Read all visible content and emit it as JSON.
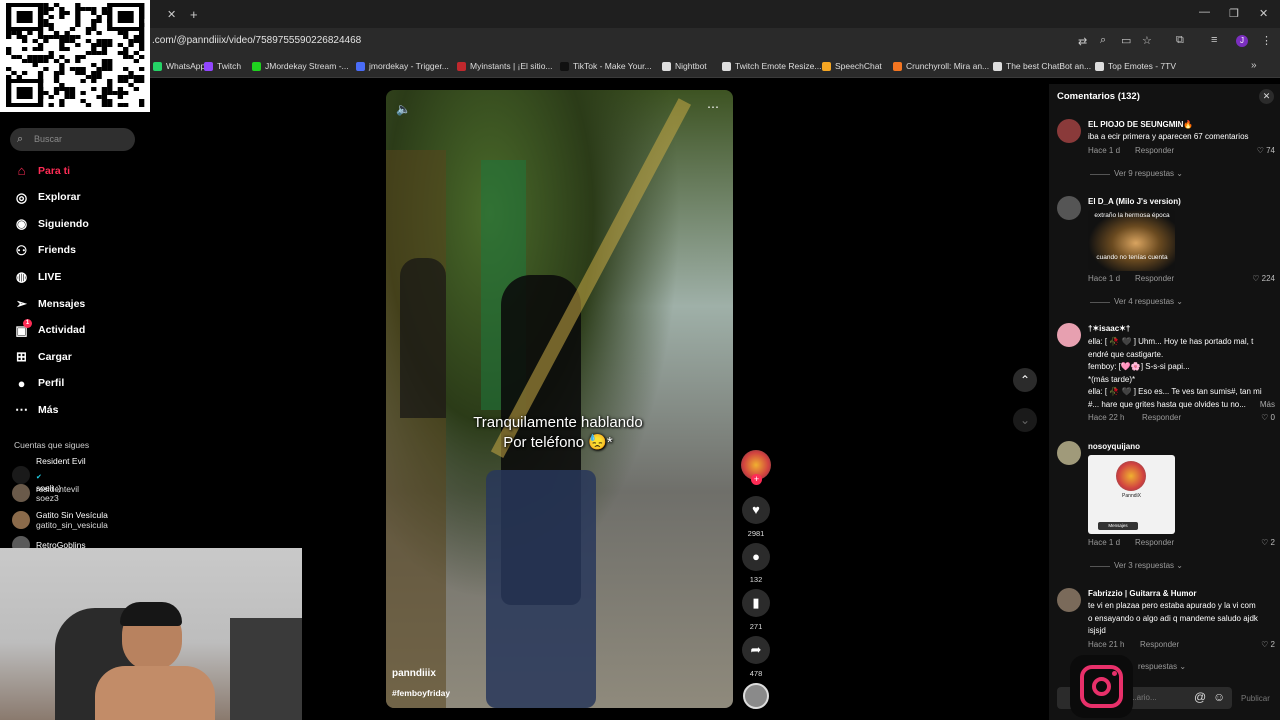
{
  "browser": {
    "url": ".com/@panndiiix/video/7589755590226824468",
    "bookmarks": [
      {
        "label": "WhatsApp",
        "color": "#25d366"
      },
      {
        "label": "Twitch",
        "color": "#9146ff"
      },
      {
        "label": "JMordekay Stream -...",
        "color": "#1fd21f"
      },
      {
        "label": "jmordekay - Trigger...",
        "color": "#4a6cf7"
      },
      {
        "label": "Myinstants | ¡El sitio...",
        "color": "#c0282d"
      },
      {
        "label": "TikTok - Make Your...",
        "color": "#111111"
      },
      {
        "label": "Nightbot",
        "color": "#dddddd"
      },
      {
        "label": "Twitch Emote Resize...",
        "color": "#dddddd"
      },
      {
        "label": "SpeechChat",
        "color": "#f5a623"
      },
      {
        "label": "Crunchyroll: Mira an...",
        "color": "#f47521"
      },
      {
        "label": "The best ChatBot an...",
        "color": "#dddddd"
      },
      {
        "label": "Top Emotes - 7TV",
        "color": "#dddddd"
      }
    ],
    "profile_initial": "J"
  },
  "sidebar": {
    "search_placeholder": "Buscar",
    "nav": [
      {
        "label": "Para ti",
        "icon": "home-icon",
        "active": true
      },
      {
        "label": "Explorar",
        "icon": "compass-icon"
      },
      {
        "label": "Siguiendo",
        "icon": "following-icon"
      },
      {
        "label": "Friends",
        "icon": "friends-icon"
      },
      {
        "label": "LIVE",
        "icon": "live-icon"
      },
      {
        "label": "Mensajes",
        "icon": "messages-icon"
      },
      {
        "label": "Actividad",
        "icon": "activity-icon",
        "badge": "1"
      },
      {
        "label": "Cargar",
        "icon": "upload-icon"
      },
      {
        "label": "Perfil",
        "icon": "profile-icon"
      },
      {
        "label": "Más",
        "icon": "more-icon"
      }
    ],
    "following_title": "Cuentas que sigues",
    "following": [
      {
        "name": "Resident Evil",
        "username": "residentevil",
        "verified": true
      },
      {
        "name": "soeli :)",
        "username": "soez3"
      },
      {
        "name": "Gatito Sin Vesícula",
        "username": "gatito_sin_vesicula"
      },
      {
        "name": "RetroGoblins",
        "username": ""
      }
    ]
  },
  "video": {
    "caption_line1": "Tranquilamente hablando",
    "caption_line2": "Por teléfono 😓*",
    "author": "panndiiix",
    "hashtag": "#femboyfriday"
  },
  "actions": {
    "likes": "2981",
    "comments": "132",
    "saves": "271",
    "shares": "478"
  },
  "comments": {
    "title": "Comentarios (132)",
    "placeholder": "...ario...",
    "publish_label": "Publicar",
    "items": [
      {
        "user": "EL PIOJO DE SEUNGMIN🔥",
        "text": "iba a ecir primera y aparecen 67 comentarios",
        "time": "Hace 1 d",
        "reply": "Responder",
        "likes": "74",
        "more": "Ver 9 respuestas"
      },
      {
        "user": "El D_A (Milo J's version)",
        "img_text1": "extraño la hermosa época",
        "img_text2": "cuando no tenías cuenta",
        "time": "Hace 1 d",
        "reply": "Responder",
        "likes": "224",
        "more": "Ver 4 respuestas"
      },
      {
        "user": "†✶isaac✶†",
        "lines": [
          "ella: [ 🥀 🖤 ] Uhm... Hoy te has portado mal, t",
          "endré que castigarte.",
          "femboy: [🩷🌸] S-s-si papi...",
          "*(más tarde)*",
          "ella: [ 🥀 🖤 ] Eso es... Te ves tan sumis#, tan mi",
          "#... hare que grites hasta que olvides tu no..."
        ],
        "more_inline": "Más",
        "time": "Hace 22 h",
        "reply": "Responder",
        "likes": "0"
      },
      {
        "user": "nosoyquijano",
        "img_name": "PanndiX",
        "img_btn": "Mensajes",
        "time": "Hace 1 d",
        "reply": "Responder",
        "likes": "2",
        "more": "Ver 3 respuestas"
      },
      {
        "user": "Fabrizzio | Guitarra & Humor",
        "lines": [
          "te vi en plazaa pero estaba apurado y la vi com",
          "o ensayando o algo adi q mandeme saludo ajdk",
          "isjsjd"
        ],
        "time": "Hace 21 h",
        "reply": "Responder",
        "likes": "2",
        "more": "respuestas"
      }
    ]
  }
}
